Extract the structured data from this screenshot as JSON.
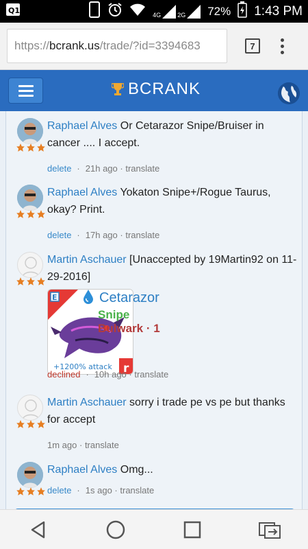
{
  "status_bar": {
    "battery_percent": "72%",
    "time": "1:43 PM",
    "network_1": "4G",
    "network_2": "2G",
    "icons": [
      "sim-icon",
      "phone-icon",
      "alarm-icon",
      "wifi-icon",
      "signal-icon",
      "battery-icon"
    ]
  },
  "browser": {
    "url_prefix": "https://",
    "url_host": "bcrank.us",
    "url_path": "/trade/?id=3394683",
    "tab_count": "7"
  },
  "site": {
    "brand": "BCRANK",
    "colors": {
      "header": "#2a6cbf",
      "link": "#2d7fc4",
      "star": "#e67e22"
    }
  },
  "comments": [
    {
      "user": "Raphael Alves",
      "text": " Or Cetarazor Snipe/Bruiser in cancer .... I accept.",
      "action": "delete",
      "time": "21h ago",
      "translate": "translate",
      "stars": 3,
      "avatar": "photo"
    },
    {
      "user": "Raphael Alves",
      "text": " Yokaton Snipe+/Rogue Taurus, okay? Print.",
      "action": "delete",
      "time": "17h ago",
      "translate": "translate",
      "stars": 3,
      "avatar": "photo"
    },
    {
      "user": "Martin Aschauer",
      "text": " [Unaccepted by 19Martin92 on 11-29-2016]",
      "status": "declined",
      "time": "10h ago",
      "translate": "translate",
      "stars": 3,
      "avatar": "ghost",
      "card": {
        "name": "Cetarazor",
        "trait": "Snipe",
        "ability": "Bulwark · 1",
        "rarity": "Epic",
        "bonus": "+1200% attack",
        "element_icon": "water-drop-icon"
      }
    },
    {
      "user": "Martin Aschauer",
      "text": " sorry i trade pe vs pe but thanks for accept",
      "time": "1m ago",
      "translate": "translate",
      "stars": 3,
      "avatar": "ghost"
    },
    {
      "user": "Raphael Alves",
      "text": " Omg...",
      "action": "delete",
      "time": "1s ago",
      "translate": "translate",
      "stars": 3,
      "avatar": "photo"
    }
  ],
  "nav": {
    "icons": [
      "back-icon",
      "home-icon",
      "recents-icon",
      "switch-icon"
    ]
  }
}
